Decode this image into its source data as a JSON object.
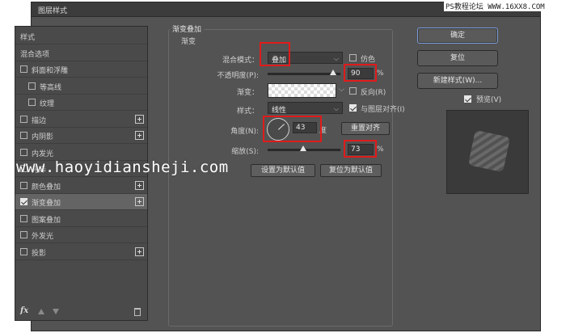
{
  "window": {
    "title": "图层样式"
  },
  "watermarks": {
    "top": "PS教程论坛 WWW.16XX8.COM",
    "middle": "www.haoyidiansheji.com"
  },
  "left_panel": {
    "items": [
      {
        "label": "样式",
        "checkbox": false,
        "checked": false,
        "plus": false,
        "indent": 0,
        "selected": false
      },
      {
        "label": "混合选项",
        "checkbox": false,
        "checked": false,
        "plus": false,
        "indent": 0,
        "selected": false
      },
      {
        "label": "斜面和浮雕",
        "checkbox": true,
        "checked": false,
        "plus": false,
        "indent": 0,
        "selected": false
      },
      {
        "label": "等高线",
        "checkbox": true,
        "checked": false,
        "plus": false,
        "indent": 1,
        "selected": false
      },
      {
        "label": "纹理",
        "checkbox": true,
        "checked": false,
        "plus": false,
        "indent": 1,
        "selected": false
      },
      {
        "label": "描边",
        "checkbox": true,
        "checked": false,
        "plus": true,
        "indent": 0,
        "selected": false
      },
      {
        "label": "内阴影",
        "checkbox": true,
        "checked": false,
        "plus": true,
        "indent": 0,
        "selected": false
      },
      {
        "label": "内发光",
        "checkbox": true,
        "checked": false,
        "plus": false,
        "indent": 0,
        "selected": false
      },
      {
        "label": "光泽",
        "checkbox": true,
        "checked": false,
        "plus": false,
        "indent": 0,
        "selected": false
      },
      {
        "label": "颜色叠加",
        "checkbox": true,
        "checked": false,
        "plus": true,
        "indent": 0,
        "selected": false
      },
      {
        "label": "渐变叠加",
        "checkbox": true,
        "checked": true,
        "plus": true,
        "indent": 0,
        "selected": true
      },
      {
        "label": "图案叠加",
        "checkbox": true,
        "checked": false,
        "plus": false,
        "indent": 0,
        "selected": false
      },
      {
        "label": "外发光",
        "checkbox": true,
        "checked": false,
        "plus": false,
        "indent": 0,
        "selected": false
      },
      {
        "label": "投影",
        "checkbox": true,
        "checked": false,
        "plus": true,
        "indent": 0,
        "selected": false
      }
    ],
    "footer": {
      "fx": "fx"
    }
  },
  "gradient_overlay": {
    "section_title": "渐变叠加",
    "subsection_title": "渐变",
    "blend_mode_label": "混合模式：",
    "blend_mode_value": "叠加",
    "dither_label": "仿色",
    "opacity_label": "不透明度(P):",
    "opacity_value": "90",
    "opacity_slider_fraction": 0.9,
    "opacity_unit": "%",
    "gradient_label": "渐变：",
    "reverse_label": "反向(R)",
    "style_label": "样式：",
    "style_value": "线性",
    "align_label": "与图层对齐(I)",
    "angle_label": "角度(N):",
    "angle_value": "43",
    "angle_unit": "度",
    "reset_align_button": "重置对齐",
    "scale_label": "缩放(S):",
    "scale_value": "73",
    "scale_slider_fraction": 0.49,
    "scale_unit": "%",
    "make_default_button": "设置为默认值",
    "reset_default_button": "复位为默认值"
  },
  "right_panel": {
    "ok_button": "确定",
    "reset_button": "复位",
    "new_style_button": "新建样式(W)...",
    "preview_label": "预览(V)"
  },
  "colors": {
    "dialog_bg": "#535353",
    "highlight_red": "#e01b1b"
  }
}
